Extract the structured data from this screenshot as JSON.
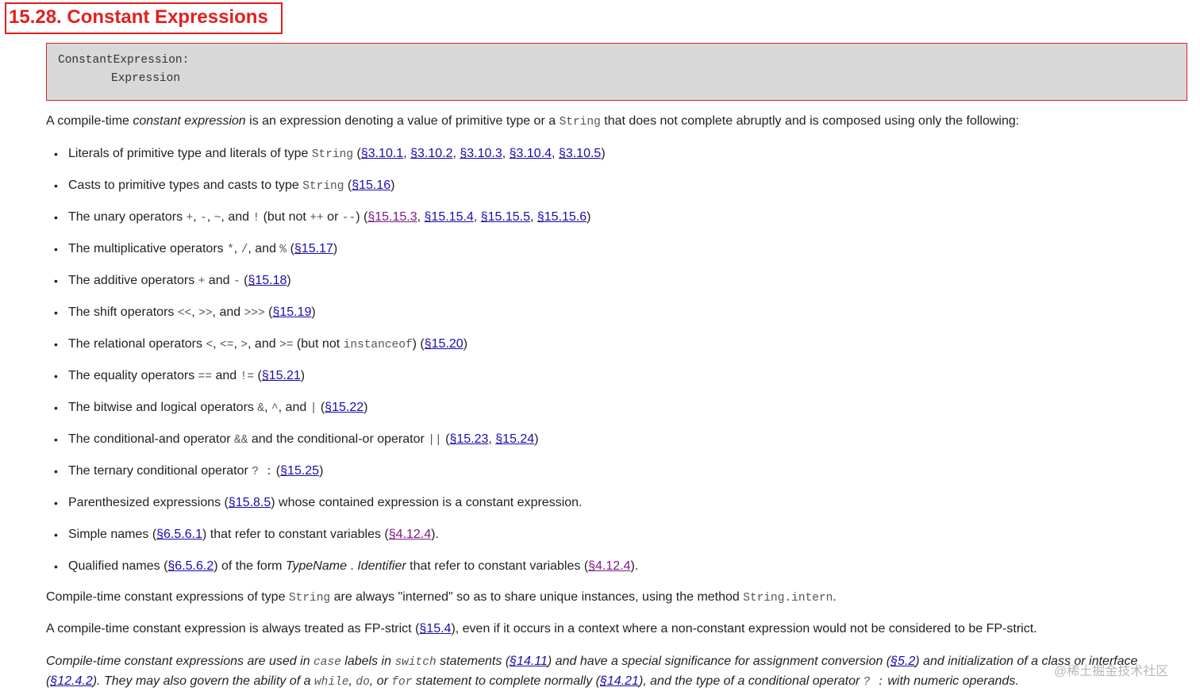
{
  "title": "15.28. Constant Expressions",
  "grammar": {
    "line1": "ConstantExpression:",
    "line2": "Expression"
  },
  "intro": {
    "before": "A compile-time ",
    "term": "constant expression",
    "mid": " is an expression denoting a value of primitive type or a ",
    "code": "String",
    "after": " that does not complete abruptly and is composed using only the following:"
  },
  "items": [
    {
      "segments": [
        {
          "t": "Literals of primitive type and literals of type "
        },
        {
          "c": "String"
        },
        {
          "t": " ("
        },
        {
          "r": "§3.10.1"
        },
        {
          "t": ", "
        },
        {
          "r": "§3.10.2"
        },
        {
          "t": ", "
        },
        {
          "r": "§3.10.3"
        },
        {
          "t": ", "
        },
        {
          "r": "§3.10.4"
        },
        {
          "t": ", "
        },
        {
          "r": "§3.10.5"
        },
        {
          "t": ")"
        }
      ]
    },
    {
      "segments": [
        {
          "t": "Casts to primitive types and casts to type "
        },
        {
          "c": "String"
        },
        {
          "t": " ("
        },
        {
          "r": "§15.16"
        },
        {
          "t": ")"
        }
      ]
    },
    {
      "segments": [
        {
          "t": "The unary operators "
        },
        {
          "c": "+"
        },
        {
          "t": ", "
        },
        {
          "c": "-"
        },
        {
          "t": ", "
        },
        {
          "c": "~"
        },
        {
          "t": ", and "
        },
        {
          "c": "!"
        },
        {
          "t": " (but not "
        },
        {
          "c": "++"
        },
        {
          "t": " or "
        },
        {
          "c": "--"
        },
        {
          "t": ") ("
        },
        {
          "r": "§15.15.3",
          "v": true
        },
        {
          "t": ", "
        },
        {
          "r": "§15.15.4"
        },
        {
          "t": ", "
        },
        {
          "r": "§15.15.5"
        },
        {
          "t": ", "
        },
        {
          "r": "§15.15.6"
        },
        {
          "t": ")"
        }
      ]
    },
    {
      "segments": [
        {
          "t": "The multiplicative operators "
        },
        {
          "c": "*"
        },
        {
          "t": ", "
        },
        {
          "c": "/"
        },
        {
          "t": ", and "
        },
        {
          "c": "%"
        },
        {
          "t": " ("
        },
        {
          "r": "§15.17"
        },
        {
          "t": ")"
        }
      ]
    },
    {
      "segments": [
        {
          "t": "The additive operators "
        },
        {
          "c": "+"
        },
        {
          "t": " and "
        },
        {
          "c": "-"
        },
        {
          "t": " ("
        },
        {
          "r": "§15.18"
        },
        {
          "t": ")"
        }
      ]
    },
    {
      "segments": [
        {
          "t": "The shift operators "
        },
        {
          "c": "<<"
        },
        {
          "t": ", "
        },
        {
          "c": ">>"
        },
        {
          "t": ", and "
        },
        {
          "c": ">>>"
        },
        {
          "t": " ("
        },
        {
          "r": "§15.19"
        },
        {
          "t": ")"
        }
      ]
    },
    {
      "segments": [
        {
          "t": "The relational operators "
        },
        {
          "c": "<"
        },
        {
          "t": ", "
        },
        {
          "c": "<="
        },
        {
          "t": ", "
        },
        {
          "c": ">"
        },
        {
          "t": ", and "
        },
        {
          "c": ">="
        },
        {
          "t": " (but not "
        },
        {
          "c": "instanceof"
        },
        {
          "t": ") ("
        },
        {
          "r": "§15.20"
        },
        {
          "t": ")"
        }
      ]
    },
    {
      "segments": [
        {
          "t": "The equality operators "
        },
        {
          "c": "=="
        },
        {
          "t": " and "
        },
        {
          "c": "!="
        },
        {
          "t": " ("
        },
        {
          "r": "§15.21"
        },
        {
          "t": ")"
        }
      ]
    },
    {
      "segments": [
        {
          "t": "The bitwise and logical operators "
        },
        {
          "c": "&"
        },
        {
          "t": ", "
        },
        {
          "c": "^"
        },
        {
          "t": ", and "
        },
        {
          "c": "|"
        },
        {
          "t": " ("
        },
        {
          "r": "§15.22"
        },
        {
          "t": ")"
        }
      ]
    },
    {
      "segments": [
        {
          "t": "The conditional-and operator "
        },
        {
          "c": "&&"
        },
        {
          "t": " and the conditional-or operator "
        },
        {
          "c": "||"
        },
        {
          "t": " ("
        },
        {
          "r": "§15.23"
        },
        {
          "t": ", "
        },
        {
          "r": "§15.24"
        },
        {
          "t": ")"
        }
      ]
    },
    {
      "segments": [
        {
          "t": "The ternary conditional operator "
        },
        {
          "c": "? :"
        },
        {
          "t": " ("
        },
        {
          "r": "§15.25"
        },
        {
          "t": ")"
        }
      ]
    },
    {
      "segments": [
        {
          "t": "Parenthesized expressions ("
        },
        {
          "r": "§15.8.5"
        },
        {
          "t": ") whose contained expression is a constant expression."
        }
      ]
    },
    {
      "segments": [
        {
          "t": "Simple names ("
        },
        {
          "r": "§6.5.6.1"
        },
        {
          "t": ") that refer to constant variables ("
        },
        {
          "r": "§4.12.4",
          "v": true
        },
        {
          "t": ")."
        }
      ]
    },
    {
      "segments": [
        {
          "t": "Qualified names ("
        },
        {
          "r": "§6.5.6.2"
        },
        {
          "t": ") of the form "
        },
        {
          "i": "TypeName"
        },
        {
          "t": " . "
        },
        {
          "i": "Identifier"
        },
        {
          "t": " that refer to constant variables ("
        },
        {
          "r": "§4.12.4",
          "v": true
        },
        {
          "t": ")."
        }
      ]
    }
  ],
  "para2": {
    "segments": [
      {
        "t": "Compile-time constant expressions of type "
      },
      {
        "c": "String"
      },
      {
        "t": " are always \"interned\" so as to share unique instances, using the method "
      },
      {
        "c": "String.intern"
      },
      {
        "t": "."
      }
    ]
  },
  "para3": {
    "segments": [
      {
        "t": "A compile-time constant expression is always treated as FP-strict ("
      },
      {
        "r": "§15.4"
      },
      {
        "t": "), even if it occurs in a context where a non-constant expression would not be considered to be FP-strict."
      }
    ]
  },
  "note": {
    "segments": [
      {
        "t": "Compile-time constant expressions are used in "
      },
      {
        "c": "case"
      },
      {
        "t": " labels in "
      },
      {
        "c": "switch"
      },
      {
        "t": " statements ("
      },
      {
        "r": "§14.11"
      },
      {
        "t": ") and have a special significance for assignment conversion ("
      },
      {
        "r": "§5.2"
      },
      {
        "t": ") and initialization of a class or interface ("
      },
      {
        "r": "§12.4.2"
      },
      {
        "t": "). They may also govern the ability of a "
      },
      {
        "c": "while"
      },
      {
        "t": ", "
      },
      {
        "c": "do"
      },
      {
        "t": ", or "
      },
      {
        "c": "for"
      },
      {
        "t": " statement to complete normally ("
      },
      {
        "r": "§14.21"
      },
      {
        "t": "), and the type of a conditional operator "
      },
      {
        "c": "? :"
      },
      {
        "t": " with numeric operands."
      }
    ]
  },
  "watermark": "@稀土掘金技术社区"
}
